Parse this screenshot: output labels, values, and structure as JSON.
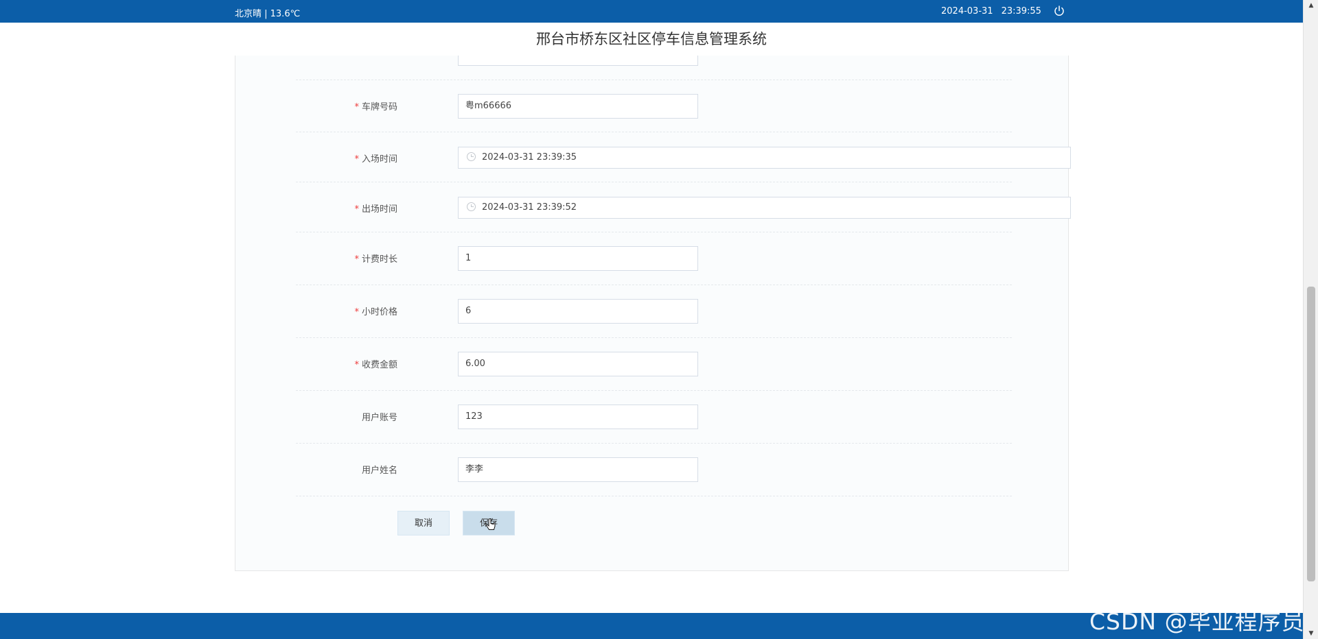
{
  "topbar": {
    "weather": "北京晴 | 13.6℃",
    "date": "2024-03-31",
    "time": "23:39:55",
    "power_icon": "power-icon"
  },
  "app_title": "邢台市桥东区社区停车信息管理系统",
  "form": {
    "plate": {
      "label": "车牌号码",
      "value": "粤m66666",
      "required": true
    },
    "entry_time": {
      "label": "入场时间",
      "value": "2024-03-31 23:39:35",
      "required": true,
      "icon": "clock-icon"
    },
    "exit_time": {
      "label": "出场时间",
      "value": "2024-03-31 23:39:52",
      "required": true,
      "icon": "clock-icon"
    },
    "duration": {
      "label": "计费时长",
      "value": "1",
      "required": true
    },
    "hourly_price": {
      "label": "小时价格",
      "value": "6",
      "required": true
    },
    "amount": {
      "label": "收费金额",
      "value": "6.00",
      "required": true
    },
    "user_account": {
      "label": "用户账号",
      "value": "123",
      "required": false
    },
    "user_name": {
      "label": "用户姓名",
      "value": "李李",
      "required": false
    }
  },
  "buttons": {
    "cancel": "取消",
    "save": "保存"
  },
  "watermark": "CSDN @毕业程序员",
  "colors": {
    "header": "#0c5ea8",
    "required": "#ee3b3b",
    "panel_bg": "#fafcfd"
  }
}
